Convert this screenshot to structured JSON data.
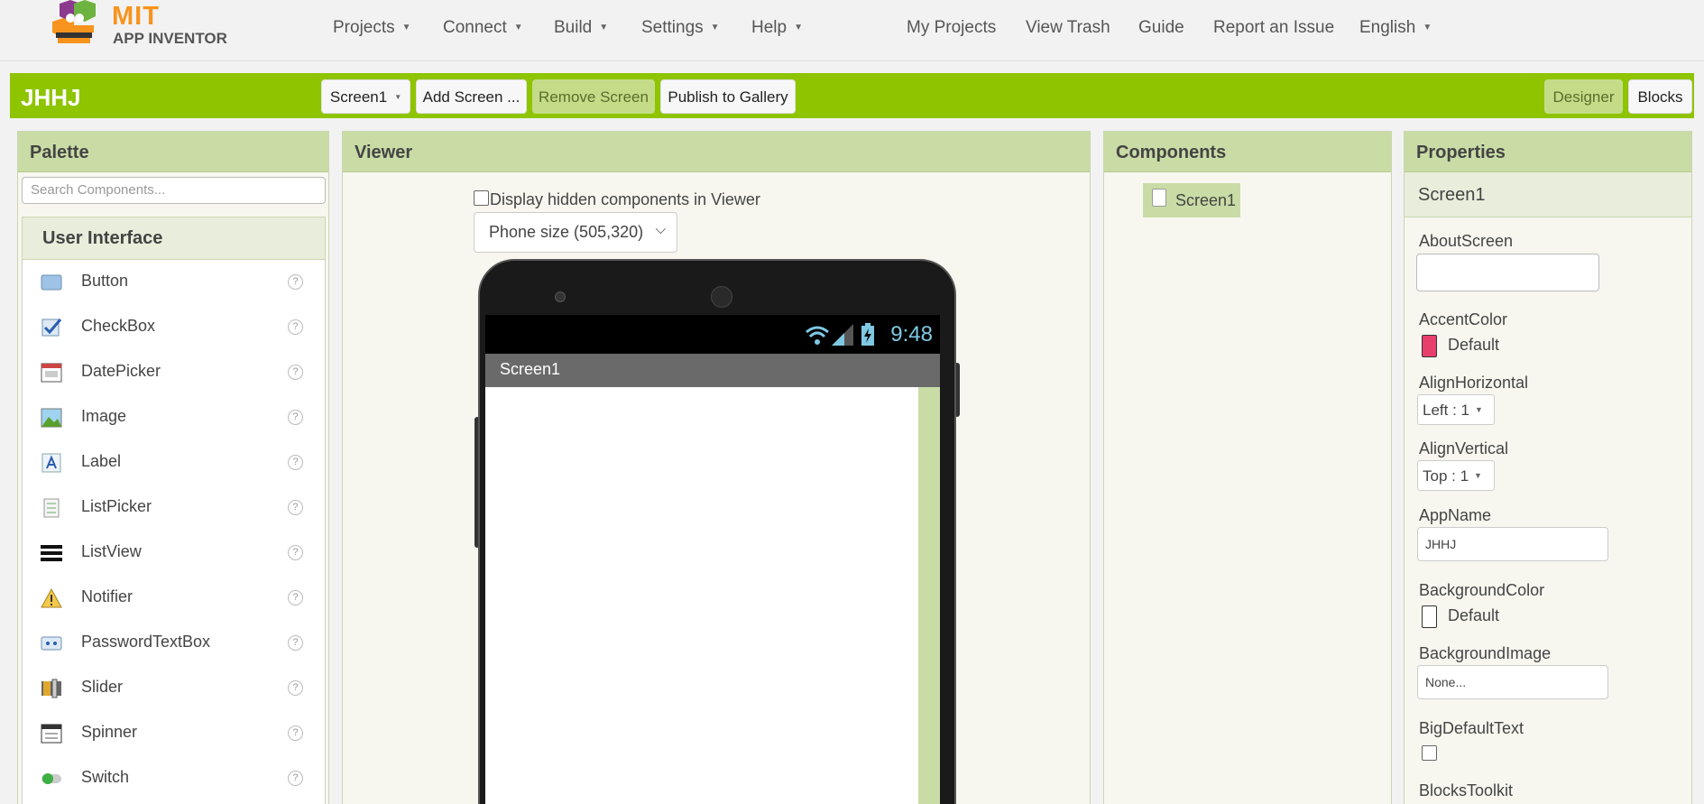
{
  "logo": {
    "mit": "MIT",
    "app_inventor": "APP INVENTOR"
  },
  "nav": {
    "projects": "Projects",
    "connect": "Connect",
    "build": "Build",
    "settings": "Settings",
    "help": "Help",
    "my_projects": "My Projects",
    "view_trash": "View Trash",
    "guide": "Guide",
    "report_issue": "Report an Issue",
    "language": "English"
  },
  "toolbar": {
    "project_name": "JHHJ",
    "screen_select": "Screen1",
    "add_screen": "Add Screen ...",
    "remove_screen": "Remove Screen",
    "publish": "Publish to Gallery",
    "designer": "Designer",
    "blocks": "Blocks"
  },
  "palette": {
    "title": "Palette",
    "search_placeholder": "Search Components...",
    "section": "User Interface",
    "help_glyph": "?",
    "items": [
      {
        "label": "Button",
        "icon": "button-icon"
      },
      {
        "label": "CheckBox",
        "icon": "checkbox-icon"
      },
      {
        "label": "DatePicker",
        "icon": "datepicker-icon"
      },
      {
        "label": "Image",
        "icon": "image-icon"
      },
      {
        "label": "Label",
        "icon": "label-icon"
      },
      {
        "label": "ListPicker",
        "icon": "listpicker-icon"
      },
      {
        "label": "ListView",
        "icon": "listview-icon"
      },
      {
        "label": "Notifier",
        "icon": "notifier-icon"
      },
      {
        "label": "PasswordTextBox",
        "icon": "password-icon"
      },
      {
        "label": "Slider",
        "icon": "slider-icon"
      },
      {
        "label": "Spinner",
        "icon": "spinner-icon"
      },
      {
        "label": "Switch",
        "icon": "switch-icon"
      }
    ]
  },
  "viewer": {
    "title": "Viewer",
    "hidden_label": "Display hidden components in Viewer",
    "size_option": "Phone size (505,320)",
    "status_time": "9:48",
    "screen_title": "Screen1"
  },
  "components": {
    "title": "Components",
    "root": "Screen1"
  },
  "properties": {
    "title": "Properties",
    "selected": "Screen1",
    "about_screen": "AboutScreen",
    "accent_color": "AccentColor",
    "accent_value": "Default",
    "accent_hex": "#e83e6c",
    "align_horizontal": "AlignHorizontal",
    "align_horizontal_value": "Left : 1",
    "align_vertical": "AlignVertical",
    "align_vertical_value": "Top : 1",
    "app_name": "AppName",
    "app_name_value": "JHHJ",
    "background_color": "BackgroundColor",
    "background_value": "Default",
    "background_hex": "#ffffff",
    "background_image": "BackgroundImage",
    "background_image_value": "None...",
    "big_default_text": "BigDefaultText",
    "blocks_toolkit": "BlocksToolkit"
  },
  "colors": {
    "toolbar_green": "#8ec400",
    "panel_header": "#c9dca6",
    "logo_orange": "#f7941d"
  }
}
